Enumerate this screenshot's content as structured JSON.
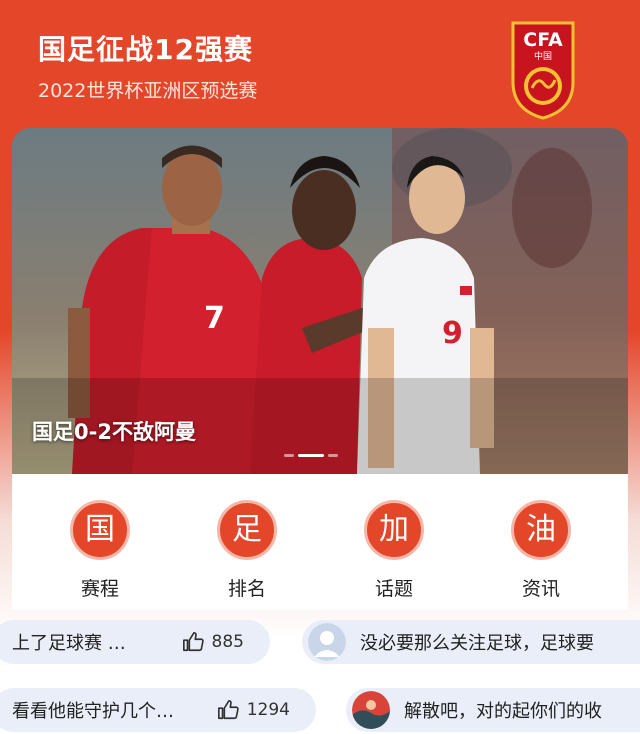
{
  "header": {
    "title": "国足征战12强赛",
    "subtitle": "2022世界杯亚洲区预选赛",
    "logo_text": "CFA",
    "logo_sub": "中国"
  },
  "hero": {
    "caption": "国足0-2不敌阿曼",
    "slide_count": 3,
    "active_slide": 2
  },
  "quick_links": [
    {
      "badge": "国",
      "label": "赛程"
    },
    {
      "badge": "足",
      "label": "排名"
    },
    {
      "badge": "加",
      "label": "话题"
    },
    {
      "badge": "油",
      "label": "资讯"
    }
  ],
  "comments": [
    {
      "text": "上了足球赛 …",
      "likes": "885"
    },
    {
      "text": "没必要那么关注足球，足球要"
    },
    {
      "text": "看看他能守护几个…",
      "likes": "1294"
    },
    {
      "text": "解散吧，对的起你们的收"
    }
  ],
  "colors": {
    "brand_red": "#E4462A",
    "pill_bg": "#E9EEF8"
  }
}
